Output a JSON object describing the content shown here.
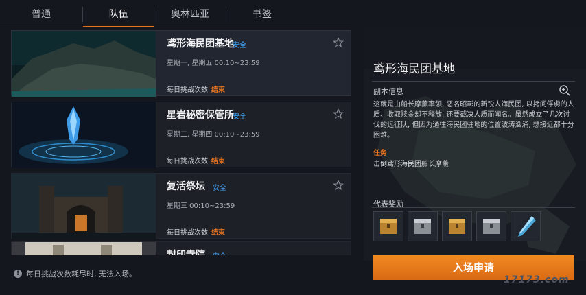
{
  "tabs": [
    {
      "label": "普通"
    },
    {
      "label": "队伍"
    },
    {
      "label": "奥林匹亚"
    },
    {
      "label": "书签"
    }
  ],
  "dungeons": [
    {
      "name": "鸢形海民团基地",
      "safety": "安全",
      "schedule": "星期一, 星期五  00:10~23:59",
      "limit_label": "每日挑战次数",
      "status": "结束"
    },
    {
      "name": "星岩秘密保管所",
      "safety": "安全",
      "schedule": "星期二, 星期四  00:10~23:59",
      "limit_label": "每日挑战次数",
      "status": "结束"
    },
    {
      "name": "复活祭坛",
      "safety": "安全",
      "schedule": "星期三  00:10~23:59",
      "limit_label": "每日挑战次数",
      "status": "结束"
    },
    {
      "name": "封印寺院",
      "safety": "安全"
    }
  ],
  "warning": {
    "text": "每日挑战次数耗尽时, 无法入场。"
  },
  "detail": {
    "title": "鸢形海民团基地",
    "info_label": "副本信息",
    "description": "这就是由船长摩薰率领, 恶名昭彰的新锐人海民团, 以拷问俘虏的人质、收取赎金却不释放, 还要截决人质而闻名。虽然成立了几次讨伐的远征队, 但因为通往海民团驻地的位置波涛汹涌, 想接近都十分困难。",
    "task_label": "任务",
    "task_text": "击倒鸢形海民团船长摩薰",
    "reward_label": "代表奖励",
    "rewards": [
      {
        "icon": "golden-chest-icon"
      },
      {
        "icon": "silver-chest-icon"
      },
      {
        "icon": "golden-chest-icon"
      },
      {
        "icon": "silver-chest-icon"
      },
      {
        "icon": "crystal-weapon-icon"
      }
    ]
  },
  "enter_button": {
    "label": "入场申请"
  },
  "watermark": "17173.com",
  "colors": {
    "accent": "#e8741e",
    "safe": "#3fa6ff",
    "background": "#14171d"
  }
}
